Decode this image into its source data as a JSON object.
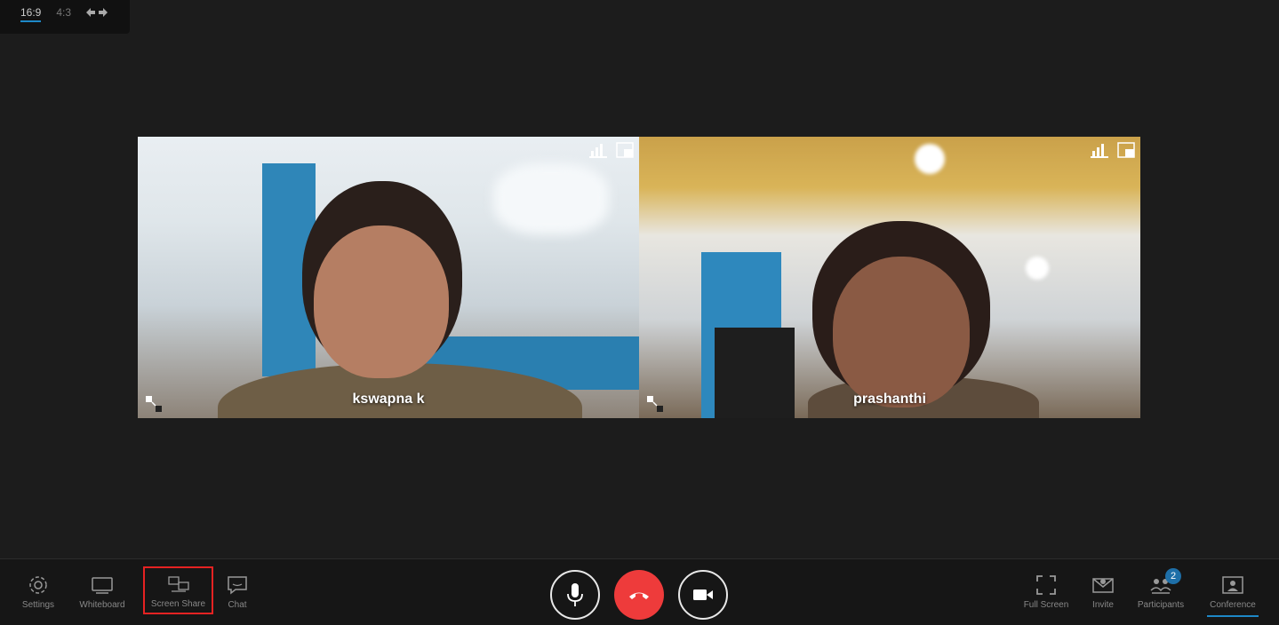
{
  "aspect": {
    "options": [
      "16:9",
      "4:3"
    ],
    "active": "16:9",
    "icon": "swap-arrows-icon"
  },
  "participants": [
    {
      "name": "kswapna k",
      "icons": [
        "signal-bars-icon",
        "layout-toggle-icon",
        "pin-icon"
      ]
    },
    {
      "name": "prashanthi",
      "icons": [
        "signal-bars-icon",
        "layout-toggle-icon",
        "pin-icon"
      ]
    }
  ],
  "toolbar": {
    "left": [
      {
        "label": "Settings",
        "icon": "gear-icon"
      },
      {
        "label": "Whiteboard",
        "icon": "whiteboard-icon"
      },
      {
        "label": "Screen Share",
        "icon": "screen-share-icon"
      },
      {
        "label": "Chat",
        "icon": "chat-icon"
      }
    ],
    "center": [
      {
        "name": "microphone",
        "icon": "microphone-icon"
      },
      {
        "name": "hang up",
        "icon": "phone-hangup-icon"
      },
      {
        "name": "camera",
        "icon": "video-camera-icon"
      }
    ],
    "right": [
      {
        "label": "Full Screen",
        "icon": "fullscreen-icon"
      },
      {
        "label": "Invite",
        "icon": "invite-icon"
      },
      {
        "label": "Participants",
        "icon": "participants-icon",
        "badge": "2"
      },
      {
        "label": "Conference",
        "icon": "conference-icon",
        "active": true
      }
    ]
  },
  "colors": {
    "accent": "#1e88c7",
    "hangup": "#ee3b3b",
    "highlight": "#e52222",
    "background": "#1c1c1c"
  }
}
